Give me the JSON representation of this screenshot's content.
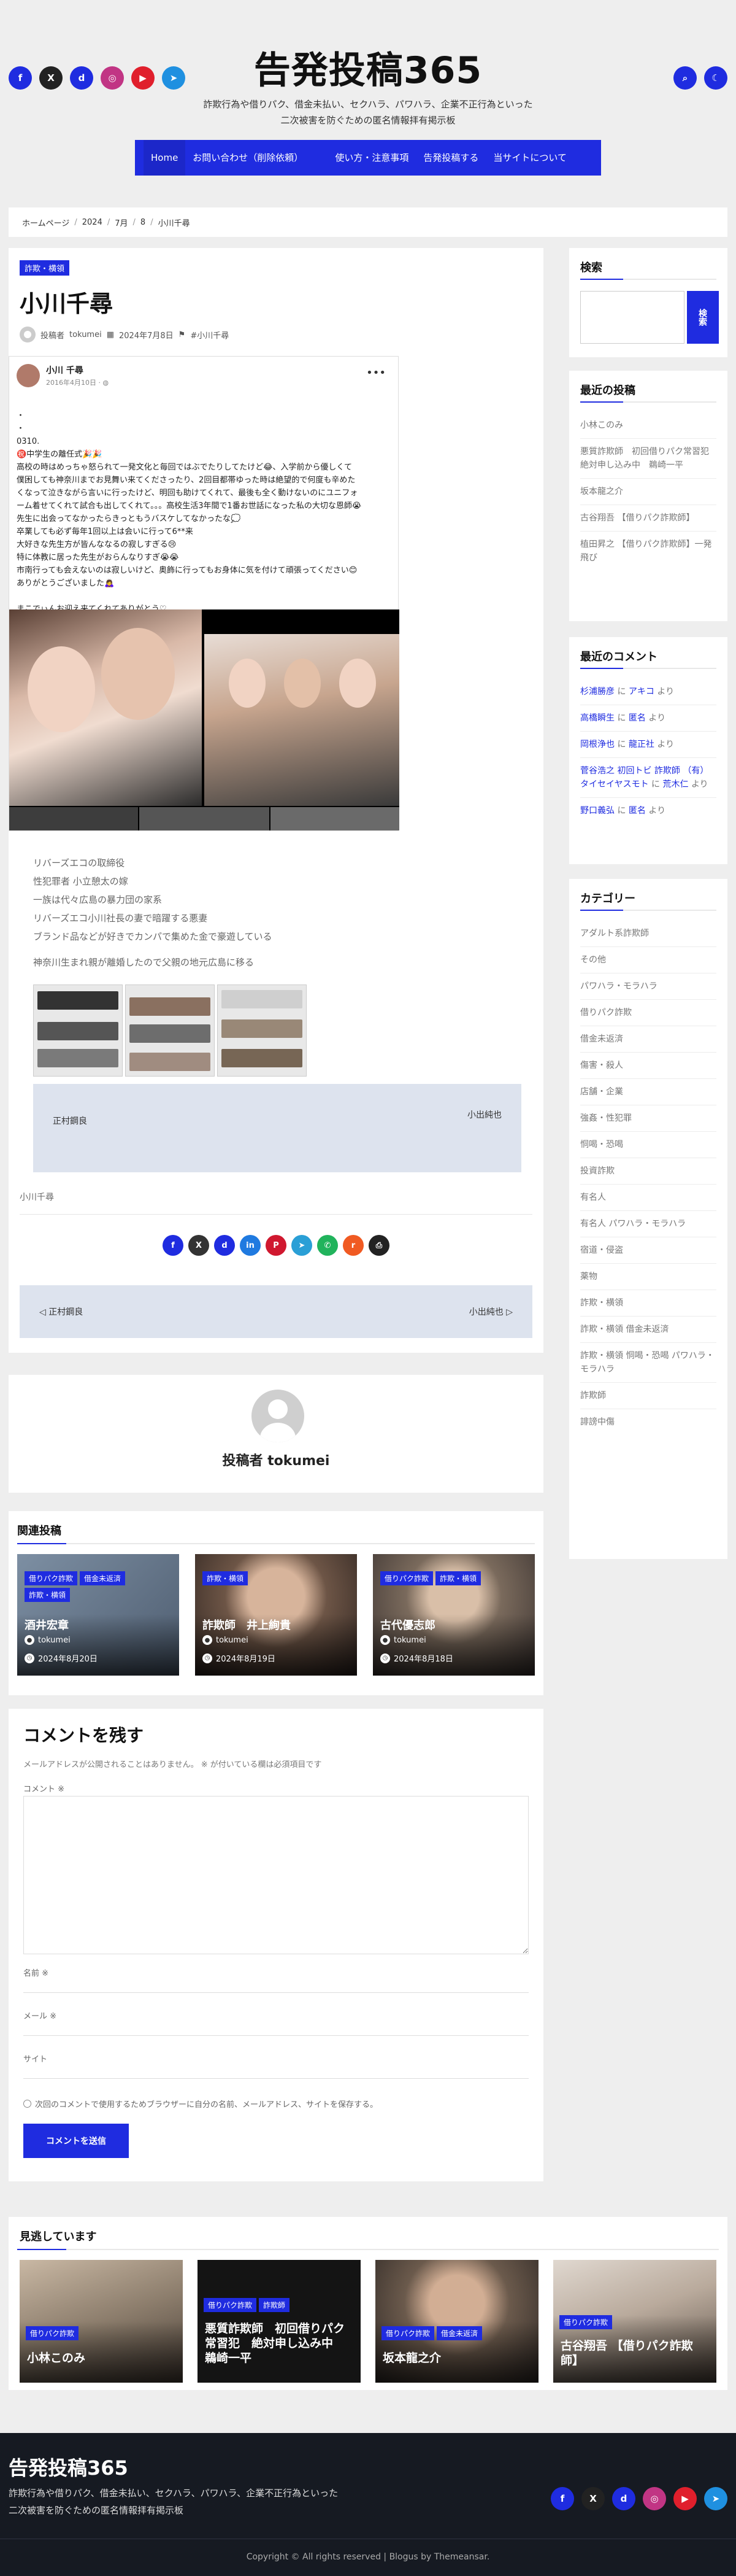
{
  "site": {
    "title": "告発投稿365",
    "tagline_line1": "詐欺行為や借りパク、借金未払い、セクハラ、パワハラ、企業不正行為といった",
    "tagline_line2": "二次被害を防ぐための匿名情報拝有掲示板"
  },
  "colors": {
    "accent": "#1f2ce0",
    "footer_bg": "#161a22",
    "page_bg": "#eeeeee"
  },
  "social_icons": [
    {
      "name": "facebook-icon",
      "glyph": "f",
      "color": "#1f2ce0"
    },
    {
      "name": "x-icon",
      "glyph": "X",
      "color": "#222222"
    },
    {
      "name": "discord-icon",
      "glyph": "d",
      "color": "#1f2ce0"
    },
    {
      "name": "instagram-icon",
      "glyph": "◎",
      "color": "#c13584"
    },
    {
      "name": "youtube-icon",
      "glyph": "▶",
      "color": "#e01f2c"
    },
    {
      "name": "telegram-icon",
      "glyph": "➤",
      "color": "#1f90e0"
    }
  ],
  "header_right": {
    "search_glyph": "⌕",
    "theme_glyph": "☾"
  },
  "nav": {
    "items": [
      "Home",
      "お問い合わせ（削除依頼）",
      "使い方・注意事項",
      "告発投稿する",
      "当サイトについて"
    ]
  },
  "breadcrumb": [
    "ホームページ",
    "2024",
    "7月",
    "8",
    "小川千尋"
  ],
  "article": {
    "category": "詐欺・横領",
    "title": "小川千尋",
    "author_prefix": "投稿者",
    "author": "tokumei",
    "date": "2024年7月8日",
    "tag": "#小川千尋",
    "embed": {
      "name": "小川 千尋",
      "date": "2016年4月10日 · ",
      "body": "・\n・\n0310.\n㊗️中学生の離任式🎉🎉\n高校の時はめっちゃ怒られて一発文化と毎回ではぶでたりしてたけど😂、入学前から優しくて\n僕困しても神奈川までお見舞い来てくださったり、2回目都帯ゆった時は絶望的で何度も辛めた\nくなって泣きながら言いに行ったけど、明回も助けてくれて、最後も全く動けないのにユニフォ\nーム着せてくれて試合も出してくれて。。。高校生活3年間で1番お世話になった私の大切な恩師😭\n先生に出会ってなかったらきっともうバスケしてなかったな💭\n卒業しても必ず毎年1回以上は会いに行って6**来\n大好きな先生方が皆んななるの寂しすぎる😢\n特に体教に居った先生がおらんなりすぎ😭😭\n市南行っても会えないのは寂しいけど、奥飾に行ってもお身体に気を付けて頑張ってください😊\nありがとうございました🙇‍♀️\n\nまこでぃんお迎え来てくれてありがとう♡"
    },
    "links": [
      "リバーズエコの取締役",
      "性犯罪者 小立憩太の嫁",
      "一族は代々広島の暴力団の家系",
      "リバーズエコ小川社長の妻で暗躍する悪妻",
      "ブランド品などが好きでカンパで集めた金で豪遊している"
    ],
    "note": "神奈川生まれ親が離婚したので父親の地元広島に移る",
    "prev_post": "正村鋼良",
    "next_post": "小出純也",
    "prev_arrow": "",
    "next_arrow": "",
    "bottom_tag": "小川千尋",
    "share_icons": [
      {
        "name": "facebook-share-icon",
        "glyph": "f",
        "color": "#1f2ce0"
      },
      {
        "name": "x-share-icon",
        "glyph": "X",
        "color": "#333333"
      },
      {
        "name": "discord-share-icon",
        "glyph": "d",
        "color": "#1f2ce0"
      },
      {
        "name": "linkedin-share-icon",
        "glyph": "in",
        "color": "#1f7ae0"
      },
      {
        "name": "pinterest-share-icon",
        "glyph": "P",
        "color": "#d0182f"
      },
      {
        "name": "telegram-share-icon",
        "glyph": "➤",
        "color": "#2a9fd6"
      },
      {
        "name": "whatsapp-share-icon",
        "glyph": "✆",
        "color": "#21b35c"
      },
      {
        "name": "reddit-share-icon",
        "glyph": "r",
        "color": "#f05a22"
      },
      {
        "name": "print-share-icon",
        "glyph": "⎙",
        "color": "#222222"
      }
    ],
    "nav2_prev": " 正村鋼良",
    "nav2_next": "小出純也 "
  },
  "author_box": {
    "label": "投稿者 tokumei"
  },
  "related": {
    "title": "関連投稿",
    "cards": [
      {
        "tags": [
          "借りパク詐欺",
          "借金未返済",
          "詐欺・横領"
        ],
        "title": "酒井宏章",
        "author": "tokumei",
        "date": "2024年8月20日"
      },
      {
        "tags": [
          "詐欺・横領"
        ],
        "title": "詐欺師　井上絢貴",
        "author": "tokumei",
        "date": "2024年8月19日"
      },
      {
        "tags": [
          "借りパク詐欺",
          "詐欺・横領"
        ],
        "title": "古代優志郎",
        "author": "tokumei",
        "date": "2024年8月18日"
      }
    ]
  },
  "comment_form": {
    "title": "コメントを残す",
    "note": "メールアドレスが公開されることはありません。 ※ が付いている欄は必須項目です",
    "comment_label": "コメント ※",
    "name_label": "名前 ※",
    "email_label": "メール ※",
    "site_label": "サイト",
    "save_label": "次回のコメントで使用するためブラウザーに自分の名前、メールアドレス、サイトを保存する。",
    "submit": "コメントを送信"
  },
  "sidebar": {
    "search": {
      "title": "検索",
      "button": "検索"
    },
    "recent": {
      "title": "最近の投稿",
      "items": [
        "小林このみ",
        "悪質詐欺師　初回借りパク常習犯　絶対申し込み中　鵜崎一平",
        "坂本龍之介",
        "古谷翔吾 【借りパク詐欺師】",
        "植田昇之 【借りパク詐欺師】一発飛び"
      ]
    },
    "comments": {
      "title": "最近のコメント",
      "items": [
        {
          "author": "杉浦勝彦",
          "on": "アキコ"
        },
        {
          "author": "高橋瞬生",
          "on": "匿名"
        },
        {
          "author": "岡根浄也",
          "on": "龍正社"
        },
        {
          "author": "菅谷浩之 初回トビ 詐欺師 （有）タイセイヤスモト",
          "on": "荒木仁"
        },
        {
          "author": "野口義弘",
          "on": "匿名"
        }
      ],
      "by": "に",
      "suffix": "より"
    },
    "categories": {
      "title": "カテゴリー",
      "items": [
        "アダルト系詐欺師",
        "その他",
        "パワハラ・モラハラ",
        "借りパク詐欺",
        "借金未返済",
        "傷害・殺人",
        "店舗・企業",
        "強姦・性犯罪",
        "恫喝・恐喝",
        "投資詐欺",
        "有名人",
        "有名人 パワハラ・モラハラ",
        "宿道・侵盗",
        "薬物",
        "詐欺・横領",
        "詐欺・横領 借金未返済",
        "詐欺・横領 恫喝・恐喝 パワハラ・モラハラ",
        "詐欺師",
        "誹謗中傷"
      ]
    }
  },
  "watching": {
    "title": "見逃しています",
    "cards": [
      {
        "tags": [
          "借りパク詐欺"
        ],
        "title": "小林このみ"
      },
      {
        "tags": [
          "借りパク詐欺",
          "詐欺師"
        ],
        "title": "悪質詐欺師　初回借りパク常習犯　絶対申し込み中　鵜崎一平"
      },
      {
        "tags": [
          "借りパク詐欺",
          "借金未返済"
        ],
        "title": "坂本龍之介"
      },
      {
        "tags": [
          "借りパク詐欺"
        ],
        "title": "古谷翔吾 【借りパク詐欺師】"
      }
    ]
  },
  "footer": {
    "title": "告発投稿365",
    "line1": "詐欺行為や借りパク、借金未払い、セクハラ、パワハラ、企業不正行為といった",
    "line2": "二次被害を防ぐための匿名情報拝有掲示板",
    "copyright": "Copyright © All rights reserved | Blogus by Themeansar."
  }
}
